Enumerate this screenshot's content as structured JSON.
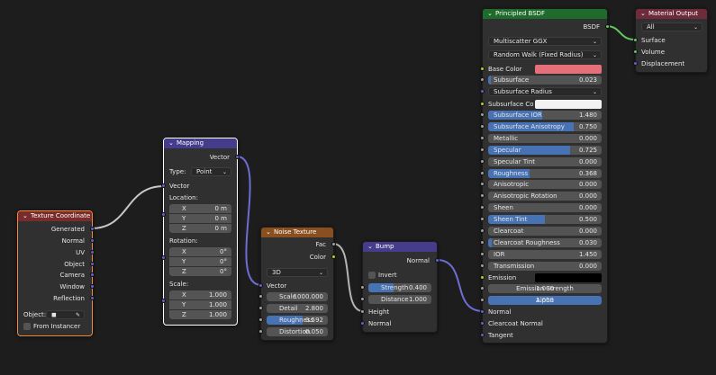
{
  "colors": {
    "background": "#1d1d1d",
    "node_body": "#303030",
    "input_header": "#7a2c2c",
    "vector_header": "#453d8c",
    "texture_header": "#8a4f1e",
    "shader_header": "#1f6b2c",
    "output_header": "#6e2b3a",
    "field": "#545454",
    "field_active": "#4772b3",
    "socket_vector": "#6363c7",
    "socket_color": "#c7c729",
    "socket_float": "#a1a1a1",
    "socket_shader": "#63c763",
    "base_color_swatch": "#e5707a",
    "subsurface_color_swatch": "#f2f2f2",
    "emission_swatch": "#000000"
  },
  "texture_coordinate": {
    "title": "Texture Coordinate",
    "outputs": [
      "Generated",
      "Normal",
      "UV",
      "Object",
      "Camera",
      "Window",
      "Reflection"
    ],
    "object_label": "Object:",
    "from_instancer": "From Instancer"
  },
  "mapping": {
    "title": "Mapping",
    "output": "Vector",
    "type_label": "Type:",
    "type_value": "Point",
    "input": "Vector",
    "location_label": "Location:",
    "location": [
      {
        "axis": "X",
        "value": "0 m"
      },
      {
        "axis": "Y",
        "value": "0 m"
      },
      {
        "axis": "Z",
        "value": "0 m"
      }
    ],
    "rotation_label": "Rotation:",
    "rotation": [
      {
        "axis": "X",
        "value": "0°"
      },
      {
        "axis": "Y",
        "value": "0°"
      },
      {
        "axis": "Z",
        "value": "0°"
      }
    ],
    "scale_label": "Scale:",
    "scale": [
      {
        "axis": "X",
        "value": "1.000"
      },
      {
        "axis": "Y",
        "value": "1.000"
      },
      {
        "axis": "Z",
        "value": "1.000"
      }
    ]
  },
  "noise_texture": {
    "title": "Noise Texture",
    "outputs": [
      "Fac",
      "Color"
    ],
    "dimensions": "3D",
    "vector": "Vector",
    "fields": [
      {
        "label": "Scale",
        "value": "1000.000",
        "fill": 0
      },
      {
        "label": "Detail",
        "value": "2.800",
        "fill": 0
      },
      {
        "label": "Roughness",
        "value": "0.592",
        "fill": 0.592
      },
      {
        "label": "Distortion",
        "value": "0.050",
        "fill": 0
      }
    ]
  },
  "bump": {
    "title": "Bump",
    "output": "Normal",
    "invert": "Invert",
    "fields": [
      {
        "label": "Strength",
        "value": "0.400",
        "fill": 0.4
      },
      {
        "label": "Distance",
        "value": "1.000",
        "fill": 0
      }
    ],
    "inputs": [
      "Height",
      "Normal"
    ]
  },
  "principled": {
    "title": "Principled BSDF",
    "output": "BSDF",
    "distribution": "Multiscatter GGX",
    "subsurface_method": "Random Walk (Fixed Radius)",
    "base_color_label": "Base Color",
    "subsurface_radius": "Subsurface Radius",
    "subsurface_color_label": "Subsurface Co",
    "emission_label": "Emission",
    "fields_a": [
      {
        "label": "Subsurface",
        "value": "0.023",
        "fill": 0.023
      }
    ],
    "fields_b": [
      {
        "label": "Subsurface IOR",
        "value": "1.480",
        "fill": 0.48
      },
      {
        "label": "Subsurface Anisotropy",
        "value": "0.750",
        "fill": 0.75
      },
      {
        "label": "Metallic",
        "value": "0.000",
        "fill": 0
      },
      {
        "label": "Specular",
        "value": "0.725",
        "fill": 0.725
      },
      {
        "label": "Specular Tint",
        "value": "0.000",
        "fill": 0
      },
      {
        "label": "Roughness",
        "value": "0.368",
        "fill": 0.368
      },
      {
        "label": "Anisotropic",
        "value": "0.000",
        "fill": 0
      },
      {
        "label": "Anisotropic Rotation",
        "value": "0.000",
        "fill": 0
      },
      {
        "label": "Sheen",
        "value": "0.000",
        "fill": 0
      },
      {
        "label": "Sheen Tint",
        "value": "0.500",
        "fill": 0.5
      },
      {
        "label": "Clearcoat",
        "value": "0.000",
        "fill": 0
      },
      {
        "label": "Clearcoat Roughness",
        "value": "0.030",
        "fill": 0.03
      },
      {
        "label": "IOR",
        "value": "1.450",
        "fill": 0
      },
      {
        "label": "Transmission",
        "value": "0.000",
        "fill": 0
      }
    ],
    "fields_c": [
      {
        "label": "Emission Strength",
        "value": "1.000",
        "fill": 0
      },
      {
        "label": "Alpha",
        "value": "1.000",
        "fill": 1
      }
    ],
    "vector_inputs": [
      "Normal",
      "Clearcoat Normal",
      "Tangent"
    ]
  },
  "material_output": {
    "title": "Material Output",
    "target": "All",
    "inputs": [
      "Surface",
      "Volume",
      "Displacement"
    ]
  }
}
